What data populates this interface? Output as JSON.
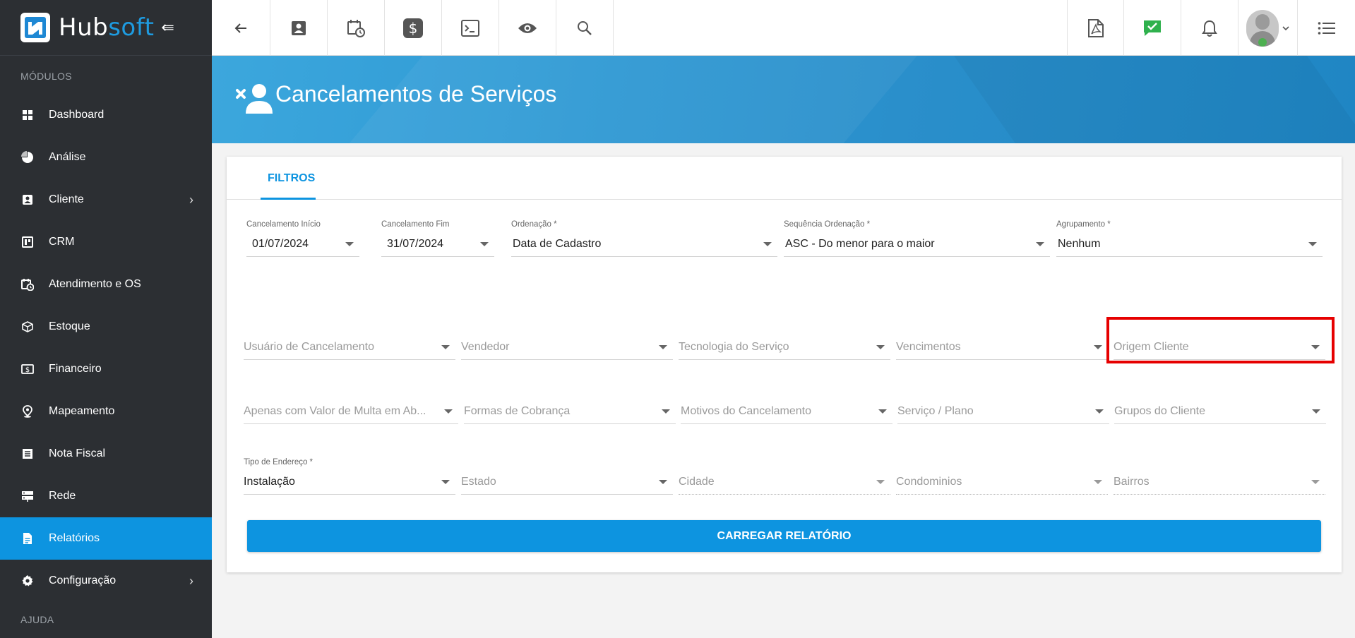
{
  "brand": {
    "name_part1": "Hub",
    "name_part2": "soft",
    "collapse_icon": "collapse-menu-icon"
  },
  "sidebar": {
    "modules_label": "MÓDULOS",
    "help_label": "AJUDA",
    "items": [
      {
        "label": "Dashboard",
        "icon": "dashboard-icon"
      },
      {
        "label": "Análise",
        "icon": "pie-chart-icon"
      },
      {
        "label": "Cliente",
        "icon": "contact-card-icon",
        "has_submenu": true
      },
      {
        "label": "CRM",
        "icon": "crm-board-icon"
      },
      {
        "label": "Atendimento e OS",
        "icon": "calendar-clock-icon"
      },
      {
        "label": "Estoque",
        "icon": "box-icon"
      },
      {
        "label": "Financeiro",
        "icon": "money-icon"
      },
      {
        "label": "Mapeamento",
        "icon": "map-pin-icon"
      },
      {
        "label": "Nota Fiscal",
        "icon": "invoice-icon"
      },
      {
        "label": "Rede",
        "icon": "server-icon"
      },
      {
        "label": "Relatórios",
        "icon": "report-file-icon",
        "active": true
      },
      {
        "label": "Configuração",
        "icon": "gear-icon",
        "has_submenu": true
      }
    ]
  },
  "topbar": {
    "left_icons": [
      "back-arrow-icon",
      "contact-card-icon",
      "calendar-clock-icon",
      "dollar-icon",
      "terminal-icon",
      "eye-icon",
      "search-icon"
    ],
    "right_icons": [
      "pdf-icon",
      "chat-check-icon",
      "bell-icon",
      "user-avatar",
      "list-menu-icon"
    ]
  },
  "page": {
    "title": "Cancelamentos de Serviços",
    "title_icon": "user-remove-icon"
  },
  "tabs": [
    {
      "label": "FILTROS",
      "active": true
    }
  ],
  "filters": {
    "row1": [
      {
        "label": "Cancelamento Início",
        "value": "01/07/2024"
      },
      {
        "label": "Cancelamento Fim",
        "value": "31/07/2024"
      },
      {
        "label": "Ordenação *",
        "value": "Data de Cadastro"
      },
      {
        "label": "Sequência Ordenação *",
        "value": "ASC - Do menor para o maior"
      },
      {
        "label": "Agrupamento *",
        "value": "Nenhum"
      }
    ],
    "row2": [
      {
        "placeholder": "Usuário de Cancelamento"
      },
      {
        "placeholder": "Vendedor"
      },
      {
        "placeholder": "Tecnologia do Serviço"
      },
      {
        "placeholder": "Vencimentos"
      },
      {
        "placeholder": "Origem Cliente"
      }
    ],
    "row3": [
      {
        "placeholder": "Apenas com Valor de Multa em Ab..."
      },
      {
        "placeholder": "Formas de Cobrança"
      },
      {
        "placeholder": "Motivos do Cancelamento"
      },
      {
        "placeholder": "Serviço / Plano"
      },
      {
        "placeholder": "Grupos do Cliente"
      }
    ],
    "row4": [
      {
        "label": "Tipo de Endereço *",
        "value": "Instalação"
      },
      {
        "placeholder": "Estado"
      },
      {
        "placeholder": "Cidade"
      },
      {
        "placeholder": "Condominios"
      },
      {
        "placeholder": "Bairros"
      }
    ]
  },
  "actions": {
    "load_report": "CARREGAR RELATÓRIO"
  },
  "colors": {
    "primary": "#0d94e0",
    "sidebar_bg": "#2c2f33",
    "highlight": "#e60000",
    "chat_green": "#2fb14d"
  }
}
